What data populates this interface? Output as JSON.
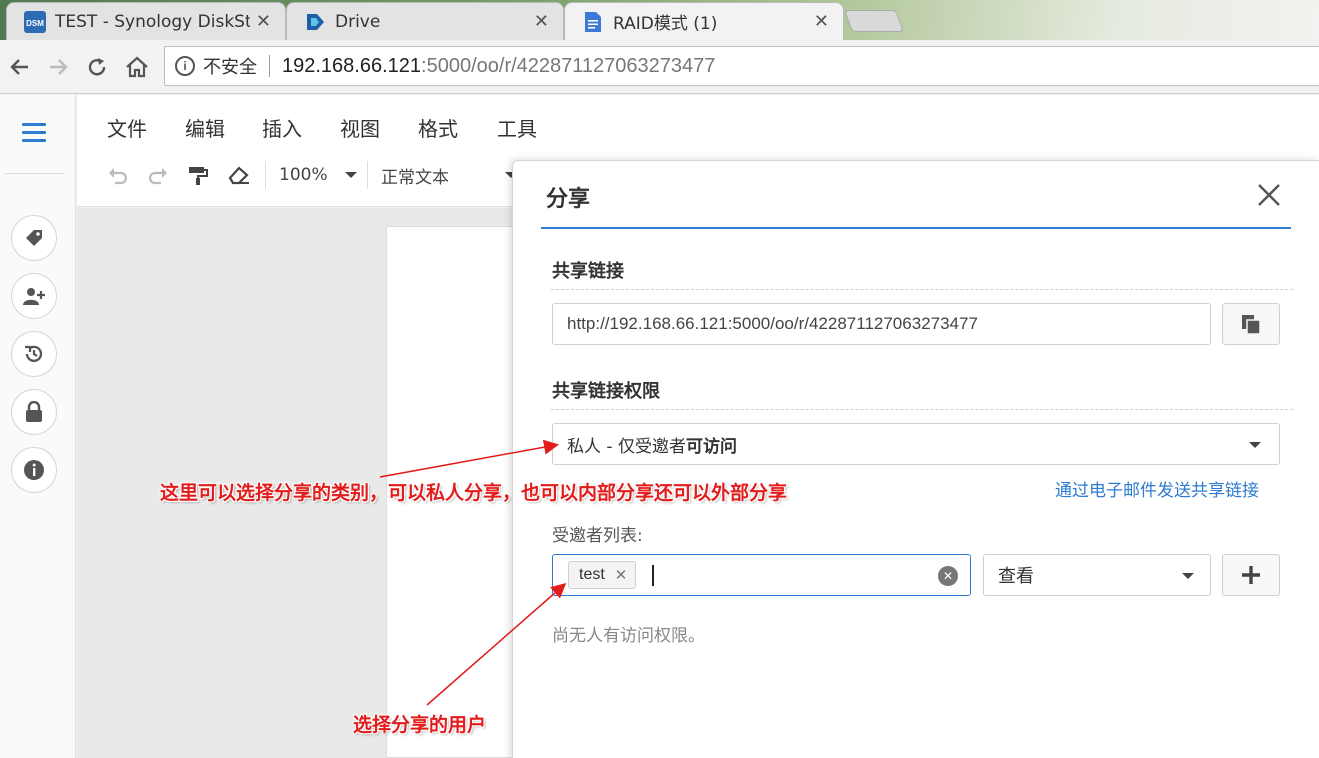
{
  "browser": {
    "tabs": [
      {
        "title": "TEST - Synology DiskSt",
        "favicon": "dsm-icon",
        "favicon_label": "DSM"
      },
      {
        "title": "Drive",
        "favicon": "drive-icon"
      },
      {
        "title": "RAID模式 (1)",
        "favicon": "document-icon"
      }
    ],
    "address": {
      "insecure_label": "不安全",
      "host": "192.168.66.121",
      "path": ":5000/oo/r/422871127063273477"
    }
  },
  "menu": {
    "items": [
      "文件",
      "编辑",
      "插入",
      "视图",
      "格式",
      "工具"
    ]
  },
  "format_toolbar": {
    "zoom": "100%",
    "style": "正常文本"
  },
  "share_panel": {
    "title": "分享",
    "link_section": "共享链接",
    "link_url": "http://192.168.66.121:5000/oo/r/422871127063273477",
    "permission_section": "共享链接权限",
    "permission_prefix": "私人 - 仅受邀者",
    "permission_bold": "可访问",
    "email_link": "通过电子邮件发送共享链接",
    "invitee_label": "受邀者列表:",
    "invitee_chip": "test",
    "role": "查看",
    "no_access_msg": "尚无人有访问权限。"
  },
  "annotations": {
    "category_note": "这里可以选择分享的类别，可以私人分享，也可以内部分享还可以外部分享",
    "user_note": "选择分享的用户"
  },
  "colors": {
    "accent": "#2e7bd0",
    "annotation": "#e21b1b"
  }
}
